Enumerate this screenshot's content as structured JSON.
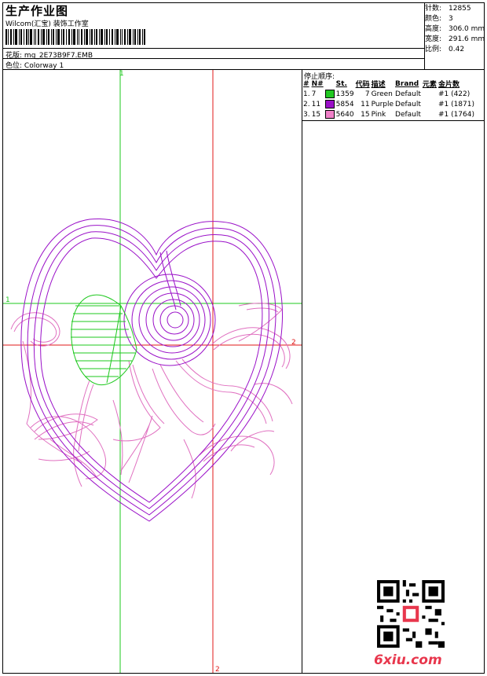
{
  "header": {
    "title": "生产作业图",
    "company": "Wilcom(汇宝) 装饰工作室",
    "design_label": "花版:",
    "design_value": "mg_2E73B9F7.EMB",
    "colorway_label": "色位:",
    "colorway_value": "Colorway 1"
  },
  "specs": [
    {
      "label": "针数:",
      "value": "12855"
    },
    {
      "label": "颜色:",
      "value": "3"
    },
    {
      "label": "高度:",
      "value": "306.0 mm"
    },
    {
      "label": "宽度:",
      "value": "291.6 mm"
    },
    {
      "label": "比例:",
      "value": "0.42"
    }
  ],
  "stops": {
    "title": "停止顺序:",
    "headers": [
      "#",
      "N#",
      "St.",
      "代码",
      "描述",
      "Brand",
      "元素",
      "金片数"
    ],
    "rows": [
      {
        "idx": "1.",
        "n": "7",
        "color": "#22c822",
        "st": "1359",
        "code": "7",
        "desc": "Green",
        "brand": "Default",
        "elem": "#1 (422)"
      },
      {
        "idx": "2.",
        "n": "11",
        "color": "#9a10c8",
        "st": "5854",
        "code": "11",
        "desc": "Purple",
        "brand": "Default",
        "elem": "#1 (1871)"
      },
      {
        "idx": "3.",
        "n": "15",
        "color": "#f080c8",
        "st": "5640",
        "code": "15",
        "desc": "Pink",
        "brand": "Default",
        "elem": "#1 (1764)"
      }
    ]
  },
  "guides": {
    "v1": "1",
    "h1": "1",
    "h2": "2",
    "v2": "2"
  },
  "watermark": {
    "logo": "6xiu.com"
  }
}
